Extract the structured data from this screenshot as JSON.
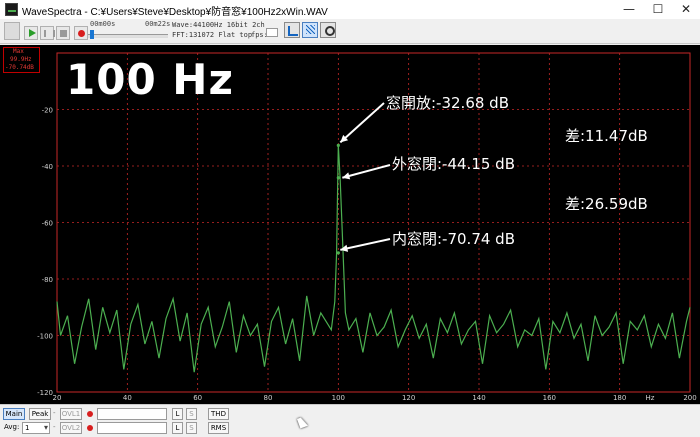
{
  "window": {
    "title": "WaveSpectra - C:¥Users¥Steve¥Desktop¥防音窓¥100Hz2xWin.WAV",
    "minimize": "—",
    "maximize": "☐",
    "close": "✕"
  },
  "toolbar": {
    "time_start": "00m00s",
    "time_end": "00m22s",
    "wave_info": "Wave:44100Hz 16bit 2ch",
    "fft_info": "FFT:131072 Flat top",
    "fps_label": "fps:"
  },
  "display": {
    "max_label": "Max",
    "max_freq": "99.9Hz",
    "max_level": "-70.74dB",
    "big_title": "100 Hz",
    "annotations": {
      "open": "窓開放:-32.68 dB",
      "outer_closed": "外窓閉:-44.15 dB",
      "inner_closed": "内窓閉:-70.74 dB",
      "diff1": "差:11.47dB",
      "diff2": "差:26.59dB"
    },
    "line_color": "#4caf50",
    "grid_color": "#c62828"
  },
  "chart_data": {
    "type": "line",
    "title": "100 Hz",
    "xlabel": "Hz",
    "ylabel": "",
    "xlim": [
      20,
      200
    ],
    "ylim": [
      -120,
      0
    ],
    "x_ticks": [
      "20",
      "40",
      "60",
      "80",
      "100",
      "120",
      "140",
      "160",
      "180",
      "200"
    ],
    "y_ticks": [
      "-20",
      "-40",
      "-60",
      "-80",
      "-100",
      "-120"
    ],
    "grid": true,
    "peaks": [
      {
        "freq": 100,
        "level": -32.68
      },
      {
        "freq": 100,
        "level": -44.15
      },
      {
        "freq": 100,
        "level": -70.74
      }
    ],
    "series": [
      {
        "x": [
          20,
          21,
          23,
          25,
          27,
          29,
          31,
          33,
          35,
          37,
          39,
          41,
          43,
          45,
          47,
          49,
          51,
          53,
          55,
          57,
          59,
          61,
          63,
          65,
          67,
          69,
          71,
          73,
          75,
          77,
          79,
          81,
          83,
          85,
          87,
          89,
          91,
          93,
          95,
          97,
          98,
          99,
          99.5,
          100,
          100.5,
          101,
          102,
          103,
          105,
          107,
          109,
          111,
          113,
          115,
          117,
          119,
          121,
          123,
          125,
          127,
          129,
          131,
          133,
          135,
          137,
          139,
          141,
          143,
          145,
          147,
          149,
          151,
          153,
          155,
          157,
          159,
          161,
          163,
          165,
          167,
          169,
          171,
          173,
          175,
          177,
          179,
          181,
          183,
          185,
          187,
          189,
          191,
          193,
          195,
          197,
          199,
          200
        ],
        "values": [
          -88,
          -100,
          -93,
          -110,
          -97,
          -87,
          -105,
          -90,
          -99,
          -91,
          -112,
          -96,
          -89,
          -103,
          -95,
          -108,
          -94,
          -87,
          -102,
          -92,
          -113,
          -96,
          -90,
          -104,
          -97,
          -88,
          -106,
          -93,
          -100,
          -96,
          -111,
          -95,
          -90,
          -103,
          -94,
          -109,
          -86,
          -100,
          -92,
          -96,
          -98,
          -88,
          -70.74,
          -32.68,
          -44.15,
          -60,
          -92,
          -98,
          -94,
          -106,
          -92,
          -100,
          -97,
          -91,
          -104,
          -98,
          -93,
          -101,
          -96,
          -108,
          -94,
          -99,
          -92,
          -103,
          -98,
          -95,
          -110,
          -93,
          -99,
          -96,
          -91,
          -104,
          -98,
          -100,
          -94,
          -112,
          -95,
          -99,
          -92,
          -101,
          -96,
          -109,
          -93,
          -100,
          -97,
          -92,
          -110,
          -95,
          -98,
          -93,
          -104,
          -96,
          -101,
          -92,
          -108,
          -95,
          -90
        ]
      }
    ]
  },
  "bottom": {
    "main_label": "Main",
    "peak_label": "Peak",
    "avg_label": "Avg:",
    "avg_value": "1",
    "ovl1_label": "OVL1",
    "ovl2_label": "OVL2",
    "l_label": "L",
    "s_label": "S",
    "thd_label": "THD",
    "rms_label": "RMS"
  }
}
